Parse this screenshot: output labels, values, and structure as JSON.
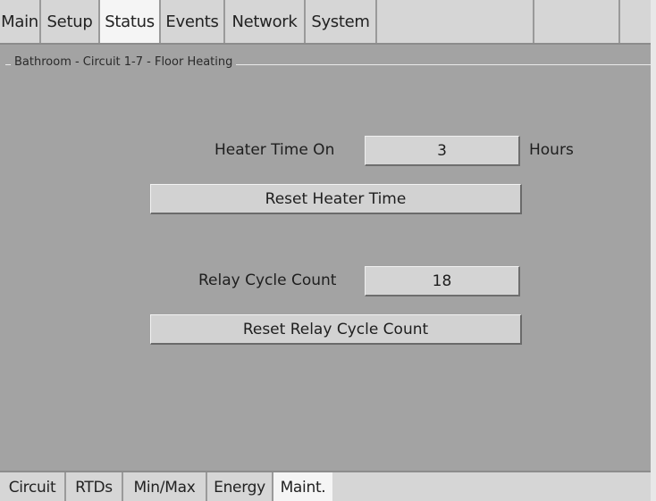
{
  "top_tabs": [
    {
      "label": "Main",
      "active": false
    },
    {
      "label": "Setup",
      "active": false
    },
    {
      "label": "Status",
      "active": true
    },
    {
      "label": "Events",
      "active": false
    },
    {
      "label": "Network",
      "active": false
    },
    {
      "label": "System",
      "active": false
    }
  ],
  "group_title": "Bathroom - Circuit 1-7 - Floor Heating",
  "heater": {
    "label": "Heater Time On",
    "value": "3",
    "unit": "Hours",
    "reset_label": "Reset Heater Time"
  },
  "relay": {
    "label": "Relay Cycle Count",
    "value": "18",
    "reset_label": "Reset Relay Cycle Count"
  },
  "bottom_tabs": [
    {
      "label": "Circuit",
      "active": false
    },
    {
      "label": "RTDs",
      "active": false
    },
    {
      "label": "Min/Max",
      "active": false
    },
    {
      "label": "Energy",
      "active": false
    },
    {
      "label": "Maint.",
      "active": true
    }
  ]
}
